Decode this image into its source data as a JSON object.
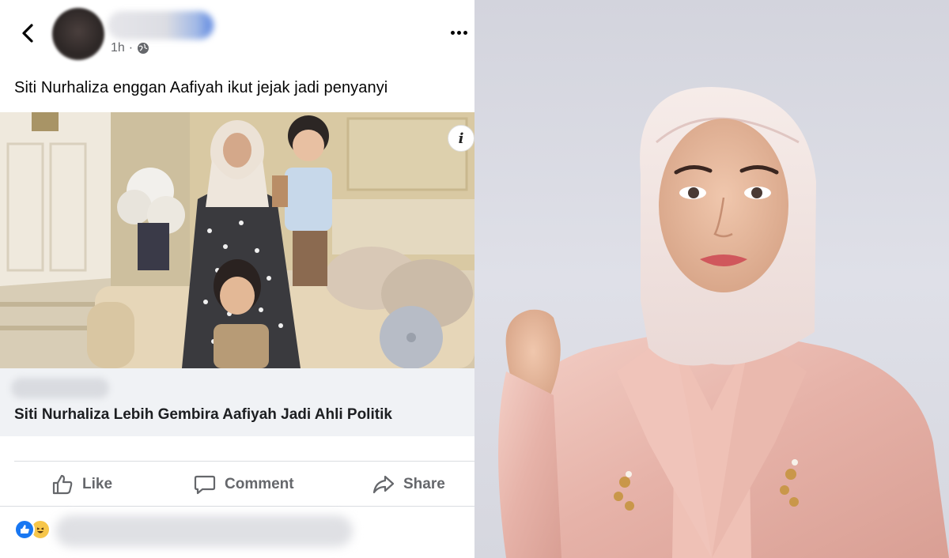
{
  "post": {
    "time": "1h",
    "separator": "·",
    "text": "Siti Nurhaliza enggan Aafiyah ikut jejak jadi penyanyi",
    "link_title": "Siti Nurhaliza Lebih Gembira Aafiyah Jadi Ahli Politik"
  },
  "actions": {
    "like": "Like",
    "comment": "Comment",
    "share": "Share"
  },
  "colors": {
    "fb_blue": "#1877f2",
    "action_gray": "#65676b",
    "link_box_bg": "#f0f2f5",
    "blazer_pink": "#e8b7ad"
  },
  "icons": [
    "back-arrow-icon",
    "globe-icon",
    "more-dots-icon",
    "info-icon",
    "like-thumb-icon",
    "comment-icon",
    "share-arrow-icon",
    "like-reaction-icon",
    "haha-reaction-icon"
  ]
}
